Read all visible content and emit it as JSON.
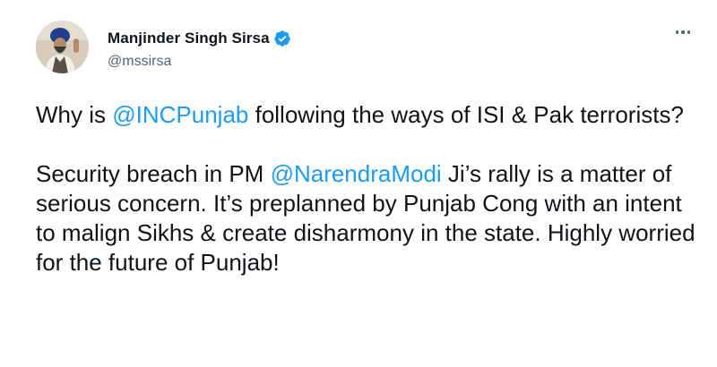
{
  "author": {
    "display_name": "Manjinder Singh Sirsa",
    "handle": "@mssirsa",
    "verified": true,
    "verified_color": "#1d9bf0"
  },
  "menu": {
    "icon": "more-horizontal-icon"
  },
  "tweet": {
    "p1": {
      "before": "Why is ",
      "mention": "@INCPunjab",
      "after": " following the ways of ISI & Pak terrorists?"
    },
    "p2": {
      "before": "Security breach in PM ",
      "mention": "@NarendraModi",
      "after": " Ji’s rally is a matter of serious concern. It’s preplanned by Punjab Cong with an intent to malign Sikhs & create disharmony in the state. Highly worried for the future of Punjab!"
    }
  },
  "colors": {
    "text": "#0f1419",
    "secondary": "#536471",
    "link": "#1d9bf0"
  }
}
